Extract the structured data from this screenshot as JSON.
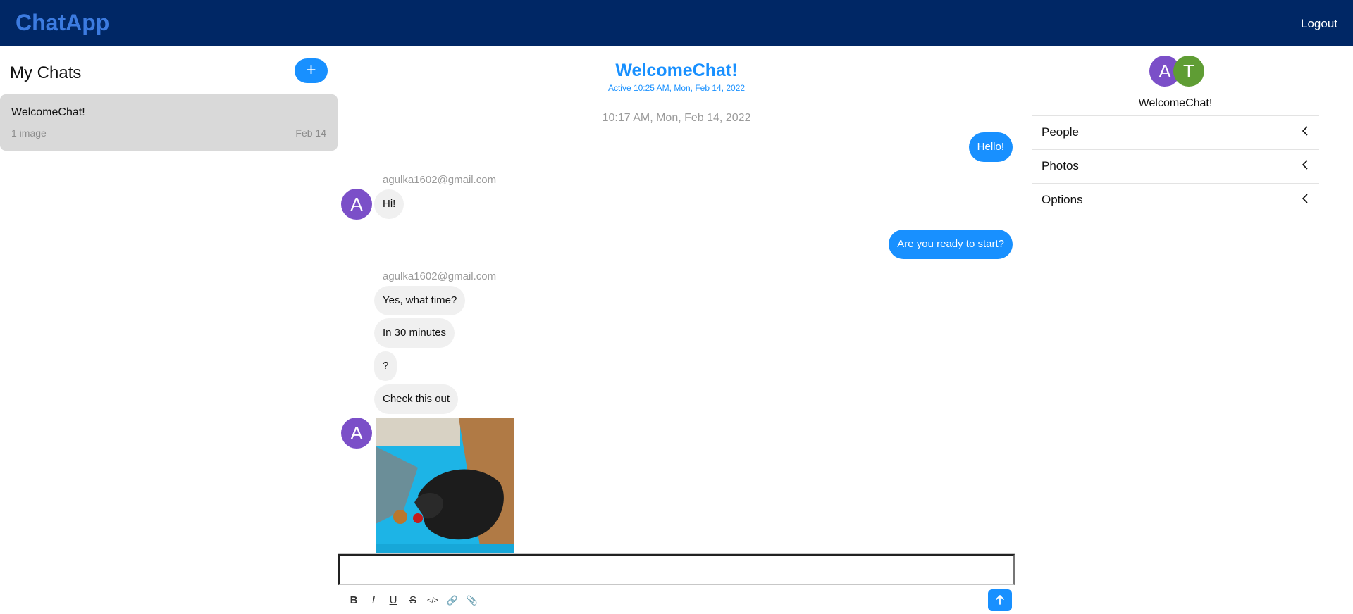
{
  "header": {
    "brand": "ChatApp",
    "logout_label": "Logout",
    "background_color": "#002765",
    "brand_color": "#3c7be0"
  },
  "chat_list": {
    "title": "My Chats",
    "add_button_label": "+",
    "items": [
      {
        "name": "WelcomeChat!",
        "preview": "1 image",
        "date": "Feb 14"
      }
    ]
  },
  "conversation": {
    "title": "WelcomeChat!",
    "status": "Active 10:25 AM, Mon, Feb 14, 2022",
    "timestamp": "10:17 AM, Mon, Feb 14, 2022",
    "accent_color": "#1890ff",
    "messages": [
      {
        "direction": "out",
        "text": "Hello!"
      },
      {
        "direction": "in",
        "sender": "agulka1602@gmail.com",
        "avatar": "A",
        "text": "Hi!"
      },
      {
        "direction": "out",
        "text": "Are you ready to start?"
      },
      {
        "direction": "in",
        "sender": "agulka1602@gmail.com",
        "text": "Yes, what time?"
      },
      {
        "direction": "in",
        "text": "In 30 minutes"
      },
      {
        "direction": "in",
        "text": "?"
      },
      {
        "direction": "in",
        "text": "Check this out"
      },
      {
        "direction": "in",
        "avatar": "A",
        "attachment": "photo-of-dog-on-blue-mat"
      }
    ]
  },
  "composer": {
    "placeholder": "",
    "tools": [
      {
        "icon": "bold-icon",
        "glyph": "B"
      },
      {
        "icon": "italic-icon",
        "glyph": "I"
      },
      {
        "icon": "underline-icon",
        "glyph": "U"
      },
      {
        "icon": "strikethrough-icon",
        "glyph": "S"
      },
      {
        "icon": "code-icon",
        "glyph": "</>"
      },
      {
        "icon": "link-icon",
        "glyph": "🔗"
      },
      {
        "icon": "attachment-icon",
        "glyph": "📎"
      }
    ],
    "send_icon": "arrow-up-icon"
  },
  "details": {
    "avatars": [
      "A",
      "T"
    ],
    "title": "WelcomeChat!",
    "sections": [
      {
        "label": "People"
      },
      {
        "label": "Photos"
      },
      {
        "label": "Options"
      }
    ]
  }
}
